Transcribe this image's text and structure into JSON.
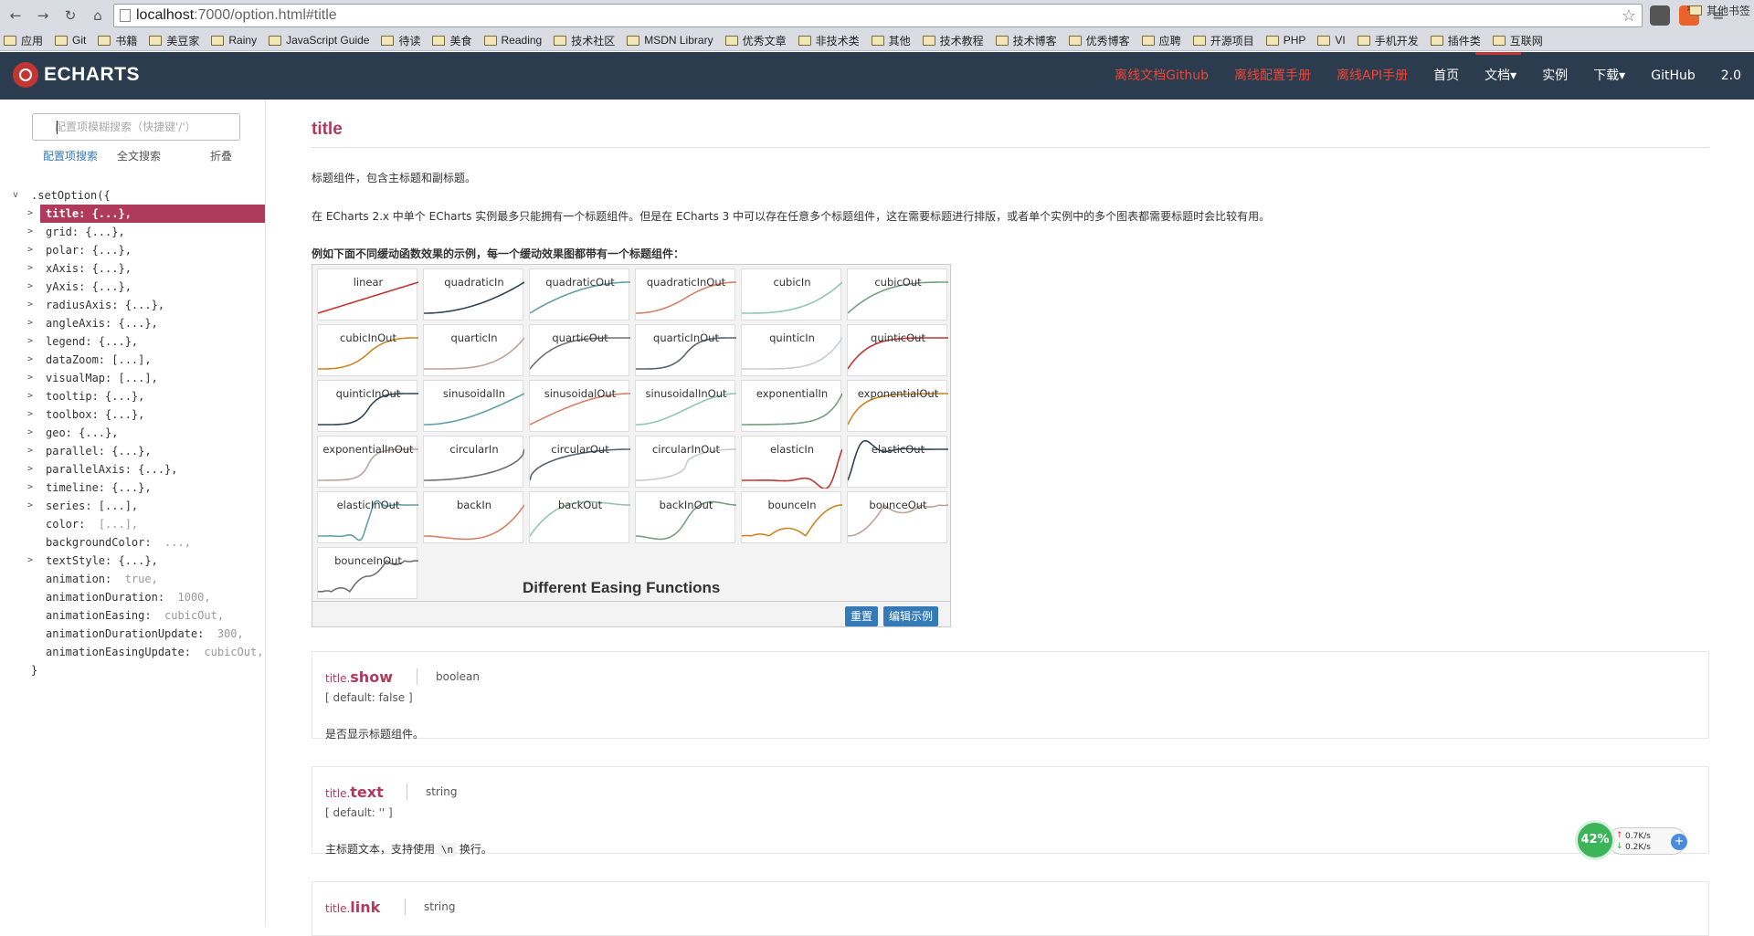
{
  "browser": {
    "url_host": "localhost",
    "url_rest": ":7000/option.html#title",
    "bookmarks": [
      "应用",
      "Git",
      "书籍",
      "美豆家",
      "Rainy",
      "JavaScript Guide",
      "待读",
      "美食",
      "Reading",
      "技术社区",
      "MSDN Library",
      "优秀文章",
      "非技术类",
      "其他",
      "技术教程",
      "技术博客",
      "优秀博客",
      "应聘",
      "开源项目",
      "PHP",
      "VI",
      "手机开发",
      "插件类",
      "互联网"
    ],
    "more": "»",
    "other_bookmarks": "其他书签"
  },
  "header": {
    "brand": "ECHARTS",
    "nav": [
      {
        "label": "离线文档Github",
        "red": true
      },
      {
        "label": "离线配置手册",
        "red": true
      },
      {
        "label": "离线API手册",
        "red": true
      },
      {
        "label": "首页",
        "red": false
      },
      {
        "label": "文档▾",
        "red": false
      },
      {
        "label": "实例",
        "red": false
      },
      {
        "label": "下载▾",
        "red": false
      },
      {
        "label": "GitHub",
        "red": false
      },
      {
        "label": "2.0",
        "red": false
      }
    ]
  },
  "sidebar": {
    "search_placeholder": "配置项模糊搜索（快捷键'/'）",
    "links": [
      "配置项搜索",
      "全文搜索",
      "折叠"
    ],
    "tree_open": ".setOption({",
    "tree_close": "}",
    "items": [
      {
        "text": "title: {...},",
        "expandable": true,
        "active": true
      },
      {
        "text": "grid: {...},",
        "expandable": true
      },
      {
        "text": "polar: {...},",
        "expandable": true
      },
      {
        "text": "xAxis: {...},",
        "expandable": true
      },
      {
        "text": "yAxis: {...},",
        "expandable": true
      },
      {
        "text": "radiusAxis: {...},",
        "expandable": true
      },
      {
        "text": "angleAxis: {...},",
        "expandable": true
      },
      {
        "text": "legend: {...},",
        "expandable": true
      },
      {
        "text": "dataZoom: [...],",
        "expandable": true
      },
      {
        "text": "visualMap: [...],",
        "expandable": true
      },
      {
        "text": "tooltip: {...},",
        "expandable": true
      },
      {
        "text": "toolbox: {...},",
        "expandable": true
      },
      {
        "text": "geo: {...},",
        "expandable": true
      },
      {
        "text": "parallel: {...},",
        "expandable": true
      },
      {
        "text": "parallelAxis: {...},",
        "expandable": true
      },
      {
        "text": "timeline: {...},",
        "expandable": true
      },
      {
        "text": "series: [...],",
        "expandable": true
      },
      {
        "key": "color:",
        "val": "[...],",
        "expandable": false
      },
      {
        "key": "backgroundColor:",
        "val": "...,",
        "expandable": false
      },
      {
        "text": "textStyle: {...},",
        "expandable": true
      },
      {
        "key": "animation:",
        "val": "true,",
        "expandable": false
      },
      {
        "key": "animationDuration:",
        "val": "1000,",
        "expandable": false
      },
      {
        "key": "animationEasing:",
        "val": "cubicOut,",
        "expandable": false
      },
      {
        "key": "animationDurationUpdate:",
        "val": "300,",
        "expandable": false
      },
      {
        "key": "animationEasingUpdate:",
        "val": "cubicOut,",
        "expandable": false
      }
    ]
  },
  "main": {
    "title": "title",
    "p1": "标题组件，包含主标题和副标题。",
    "p2": "在 ECharts 2.x 中单个 ECharts 实例最多只能拥有一个标题组件。但是在 ECharts 3 中可以存在任意多个标题组件，这在需要标题进行排版，或者单个实例中的多个图表都需要标题时会比较有用。",
    "p3": "例如下面不同缓动函数效果的示例，每一个缓动效果图都带有一个标题组件：",
    "demo_title": "Different Easing Functions",
    "reset_label": "重置",
    "edit_label": "编辑示例",
    "easings": [
      "linear",
      "quadraticIn",
      "quadraticOut",
      "quadraticInOut",
      "cubicIn",
      "cubicOut",
      "cubicInOut",
      "quarticIn",
      "quarticOut",
      "quarticInOut",
      "quinticIn",
      "quinticOut",
      "quinticInOut",
      "sinusoidalIn",
      "sinusoidalOut",
      "sinusoidalInOut",
      "exponentialIn",
      "exponentialOut",
      "exponentialInOut",
      "circularIn",
      "circularOut",
      "circularInOut",
      "elasticIn",
      "elasticOut",
      "elasticInOut",
      "backIn",
      "backOut",
      "backInOut",
      "bounceIn",
      "bounceOut",
      "bounceInOut"
    ],
    "palette": [
      "#c23531",
      "#2f4554",
      "#61a0a8",
      "#d48265",
      "#91c7ae",
      "#749f83",
      "#ca8622",
      "#bda29a",
      "#6e7074",
      "#546570",
      "#c4ccd3"
    ],
    "props": [
      {
        "prefix": "title.",
        "name": "show",
        "type": "boolean",
        "default": "[ default: false ]",
        "desc": "是否显示标题组件。"
      },
      {
        "prefix": "title.",
        "name": "text",
        "type": "string",
        "default": "[ default: '' ]",
        "desc_before": "主标题文本，支持使用 ",
        "desc_code": "\\n",
        "desc_after": " 换行。"
      },
      {
        "prefix": "title.",
        "name": "link",
        "type": "string"
      }
    ]
  },
  "net_widget": {
    "percent": "42%",
    "up": "0.7K/s",
    "down": "0.2K/s"
  }
}
